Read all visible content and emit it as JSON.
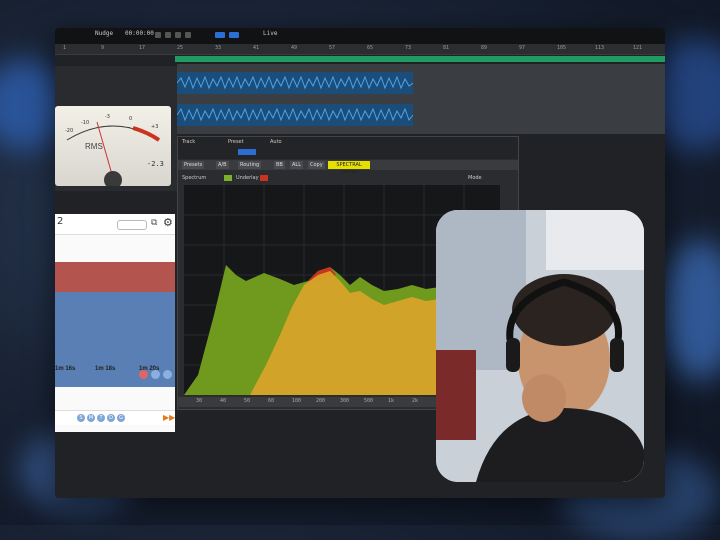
{
  "transport": {
    "mode_label": "Nudge",
    "sync_label": "Sync",
    "live_label": "Live",
    "timecode": "00:00:00"
  },
  "ruler_marks": [
    "1",
    "9",
    "17",
    "25",
    "33",
    "41",
    "49",
    "57",
    "65",
    "73",
    "81",
    "89",
    "97",
    "105",
    "113",
    "121"
  ],
  "vu_meter": {
    "label": "RMS",
    "value": "-2.3",
    "scale": [
      "-20",
      "-10",
      "-7",
      "-5",
      "-3",
      "-1",
      "0",
      "+1",
      "+2",
      "+3"
    ]
  },
  "side_panel": {
    "number": "2",
    "times": [
      "1m 16s",
      "1m 18s",
      "1m 20s"
    ],
    "buttons": [
      "S",
      "M",
      "T",
      "D",
      "G"
    ]
  },
  "plugin": {
    "header_labels": [
      "Track",
      "Preset",
      "Auto"
    ],
    "bar_items": [
      "Presets",
      "A/B",
      "Routing",
      "BB",
      "ALL",
      "Copy"
    ],
    "highlight": "SPECTRAL DELTA",
    "tools": [
      "Spectrum",
      "Underlay"
    ],
    "mode_label": "Mode",
    "freq_labels": [
      "30",
      "40",
      "50",
      "60",
      "100",
      "200",
      "300",
      "500",
      "1k",
      "2k",
      "3k",
      "5k",
      "10k"
    ]
  },
  "colors": {
    "green_layer": "#6f9a1e",
    "orange_layer": "#d9a52a",
    "red_peak": "#c8341f",
    "accent": "#1f9a63"
  }
}
